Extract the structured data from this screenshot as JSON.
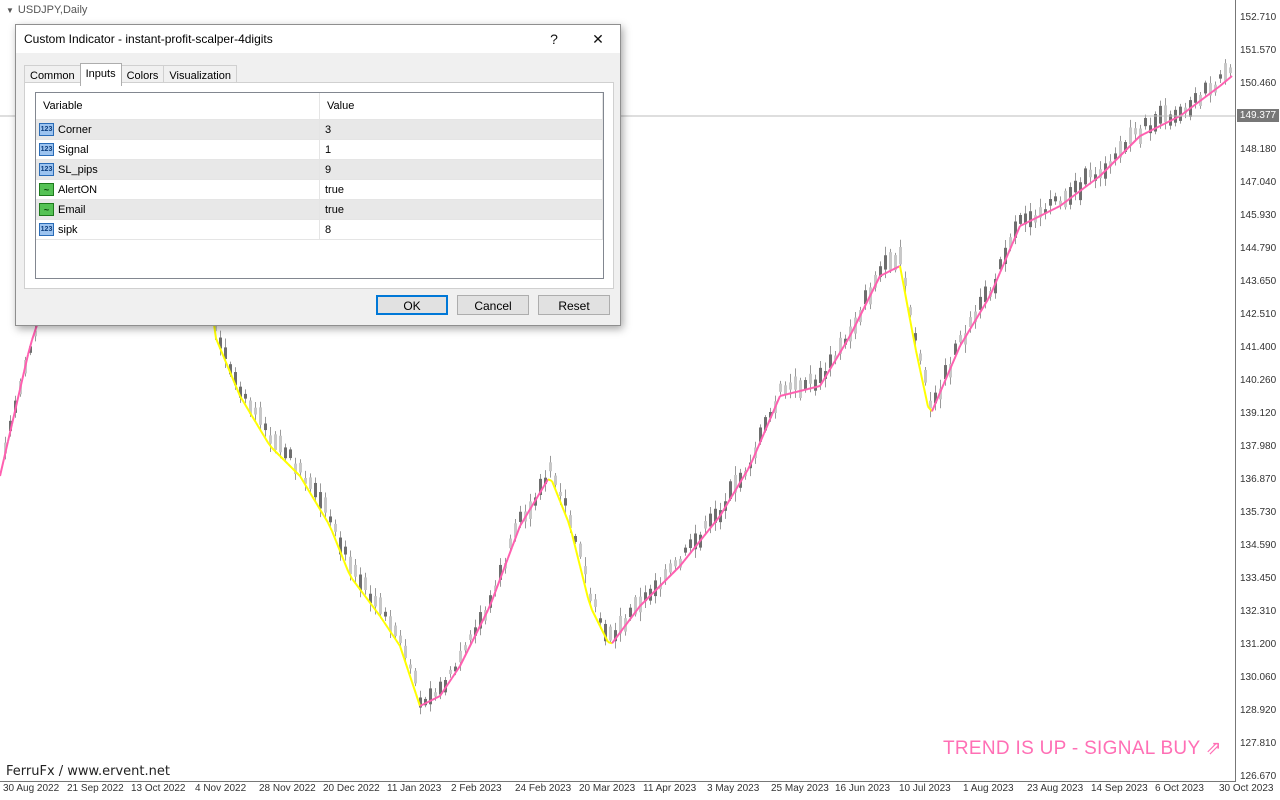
{
  "chart": {
    "title": "USDJPY,Daily",
    "watermark": "FerruFx / www.ervent.net",
    "trend_text": "TREND IS UP - SIGNAL BUY ⇗",
    "current_price": "149.377",
    "price_labels": [
      "152.710",
      "151.570",
      "150.460",
      "149.377",
      "148.180",
      "147.040",
      "145.930",
      "144.790",
      "143.650",
      "142.510",
      "141.400",
      "140.260",
      "139.120",
      "137.980",
      "136.870",
      "135.730",
      "134.590",
      "133.450",
      "132.310",
      "131.200",
      "130.060",
      "128.920",
      "127.810",
      "126.670"
    ],
    "date_labels": [
      "30 Aug 2022",
      "21 Sep 2022",
      "13 Oct 2022",
      "4 Nov 2022",
      "28 Nov 2022",
      "20 Dec 2022",
      "11 Jan 2023",
      "2 Feb 2023",
      "24 Feb 2023",
      "20 Mar 2023",
      "11 Apr 2023",
      "3 May 2023",
      "25 May 2023",
      "16 Jun 2023",
      "10 Jul 2023",
      "1 Aug 2023",
      "23 Aug 2023",
      "14 Sep 2023",
      "6 Oct 2023",
      "30 Oct 2023"
    ],
    "colors": {
      "up_trend": "#ff5fb0",
      "down_trend": "#ffff00",
      "candle": "#9a9a9a",
      "trend_text": "#ff6fb5"
    }
  },
  "dialog": {
    "title": "Custom Indicator - instant-profit-scalper-4digits",
    "help_label": "?",
    "close_label": "✕",
    "tabs": [
      {
        "label": "Common"
      },
      {
        "label": "Inputs"
      },
      {
        "label": "Colors"
      },
      {
        "label": "Visualization"
      }
    ],
    "active_tab": "Inputs",
    "table": {
      "headers": [
        "Variable",
        "Value"
      ],
      "rows": [
        {
          "name": "Corner",
          "value": "3",
          "icon": "integer-icon",
          "icon_text": "123"
        },
        {
          "name": "Signal",
          "value": "1",
          "icon": "integer-icon",
          "icon_text": "123"
        },
        {
          "name": "SL_pips",
          "value": "9",
          "icon": "integer-icon",
          "icon_text": "123"
        },
        {
          "name": "AlertON",
          "value": "true",
          "icon": "boolean-icon",
          "icon_text": "~"
        },
        {
          "name": "Email",
          "value": "true",
          "icon": "boolean-icon",
          "icon_text": "~"
        },
        {
          "name": "sipk",
          "value": "8",
          "icon": "integer-icon",
          "icon_text": "123"
        }
      ]
    },
    "buttons": {
      "ok": "OK",
      "cancel": "Cancel",
      "reset": "Reset"
    }
  }
}
